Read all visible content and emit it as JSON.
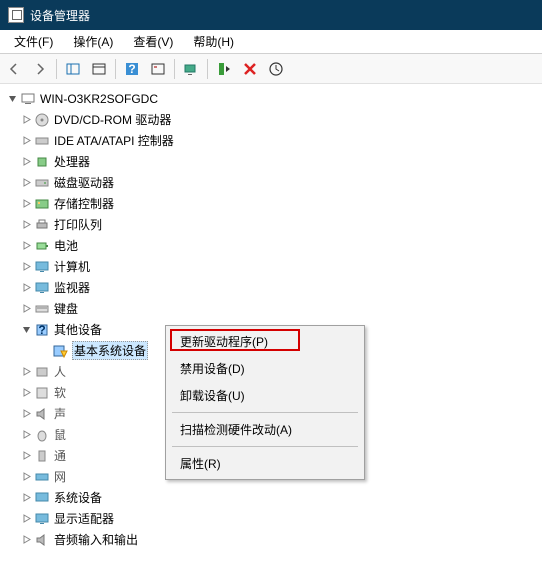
{
  "title": "设备管理器",
  "menu": {
    "file": "文件(F)",
    "action": "操作(A)",
    "view": "查看(V)",
    "help": "帮助(H)"
  },
  "root": "WIN-O3KR2SOFGDC",
  "nodes": {
    "dvd": "DVD/CD-ROM 驱动器",
    "ide": "IDE ATA/ATAPI 控制器",
    "cpu": "处理器",
    "disk": "磁盘驱动器",
    "storage": "存储控制器",
    "print": "打印队列",
    "battery": "电池",
    "computer": "计算机",
    "monitor": "监视器",
    "keyboard": "键盘",
    "other": "其他设备",
    "sel": "基本系统设备",
    "hid": "人",
    "soft": "软",
    "audio": "声",
    "mouse": "鼠",
    "usb": "通",
    "net": "网",
    "system": "系统设备",
    "display": "显示适配器",
    "sound": "音频输入和输出"
  },
  "ctx": {
    "update": "更新驱动程序(P)",
    "disable": "禁用设备(D)",
    "uninstall": "卸载设备(U)",
    "scan": "扫描检测硬件改动(A)",
    "props": "属性(R)"
  }
}
